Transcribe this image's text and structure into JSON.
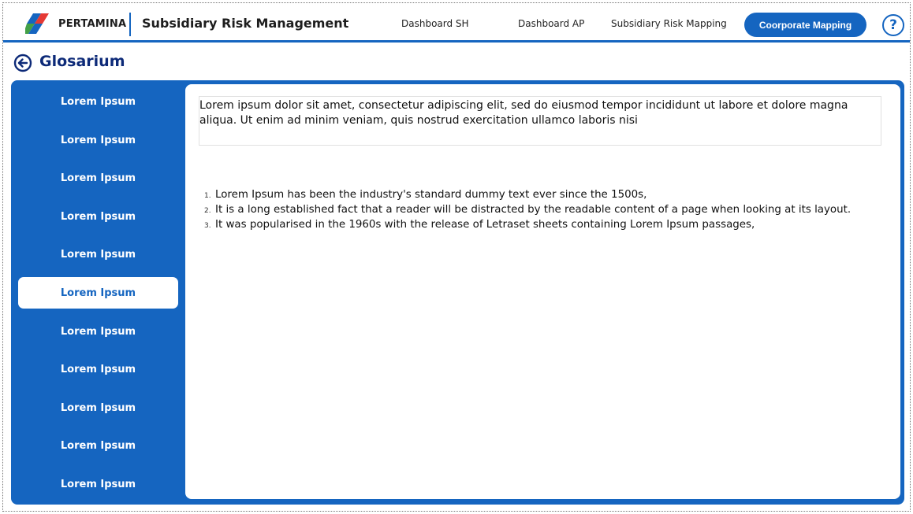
{
  "header": {
    "brand": "PERTAMINA",
    "app_title": "Subsidiary Risk Management",
    "nav": [
      "Dashboard SH",
      "Dashboard AP",
      "Subsidiary Risk Mapping"
    ],
    "primary_nav": "Coorporate Mapping",
    "help": "?"
  },
  "page": {
    "title": "Glosarium"
  },
  "sidebar": {
    "items": [
      {
        "label": "Lorem Ipsum"
      },
      {
        "label": "Lorem Ipsum"
      },
      {
        "label": "Lorem Ipsum"
      },
      {
        "label": "Lorem Ipsum"
      },
      {
        "label": "Lorem Ipsum"
      },
      {
        "label": "Lorem Ipsum"
      },
      {
        "label": "Lorem Ipsum"
      },
      {
        "label": "Lorem Ipsum"
      },
      {
        "label": "Lorem Ipsum"
      },
      {
        "label": "Lorem Ipsum"
      },
      {
        "label": "Lorem Ipsum"
      }
    ],
    "active_index": 5
  },
  "content": {
    "description": "Lorem ipsum dolor sit amet, consectetur adipiscing elit, sed do eiusmod tempor incididunt ut labore et dolore magna aliqua. Ut enim ad minim veniam, quis nostrud exercitation ullamco laboris nisi",
    "list": [
      {
        "num": "1.",
        "text": "Lorem Ipsum has been the industry's standard dummy text ever since the 1500s,"
      },
      {
        "num": "2.",
        "text": "It is a long established fact that a reader will be distracted by the readable content of a page when looking at its layout."
      },
      {
        "num": "3.",
        "text": "It was popularised in the 1960s with the release of Letraset sheets containing Lorem Ipsum passages,"
      }
    ]
  },
  "colors": {
    "primary": "#1565c0",
    "title": "#0d2a78"
  }
}
